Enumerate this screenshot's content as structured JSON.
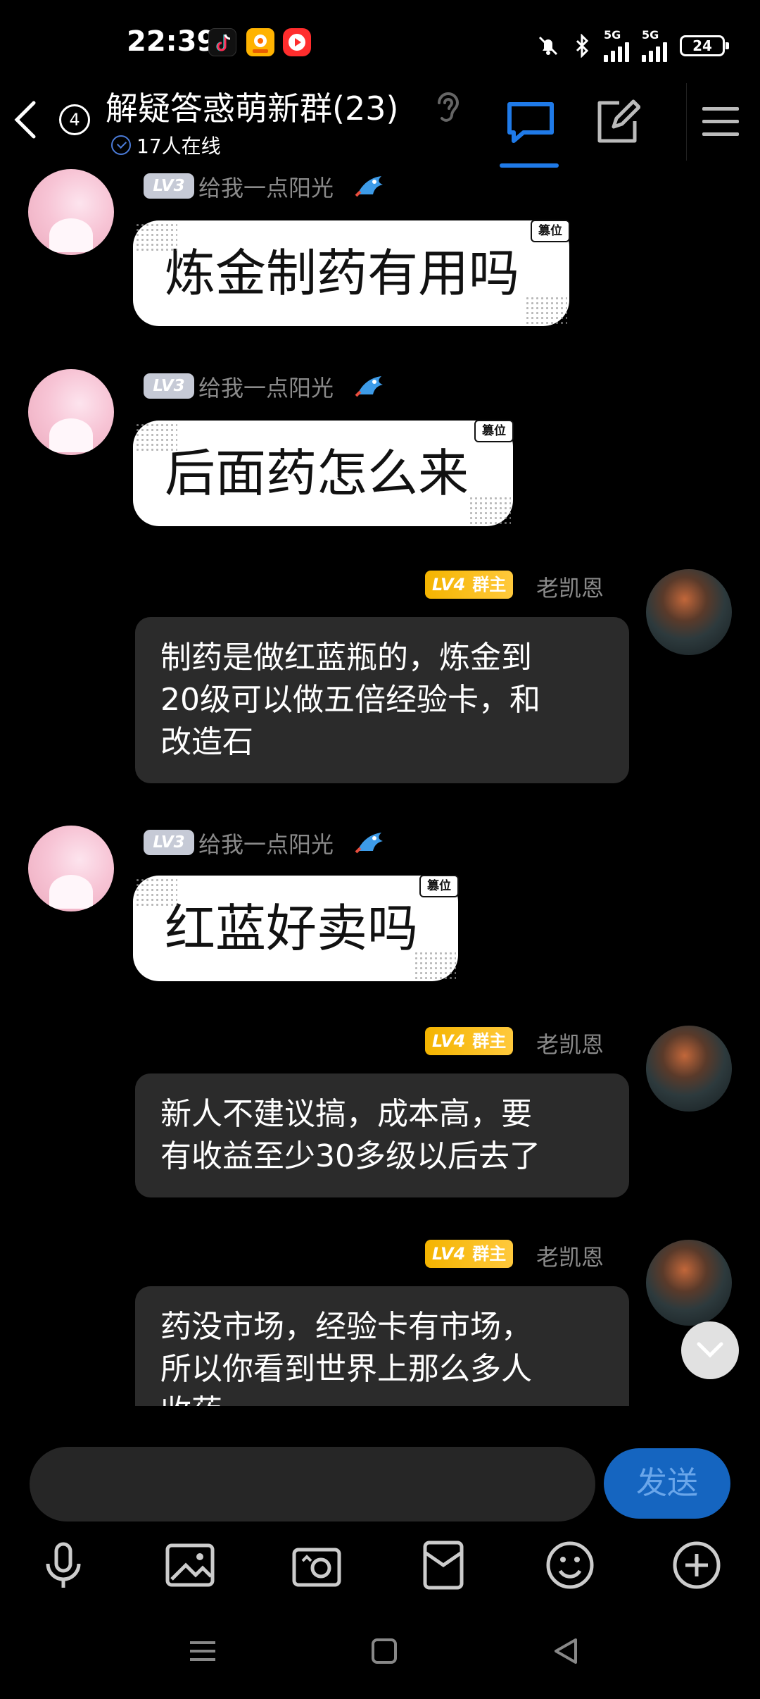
{
  "status_bar": {
    "time": "22:39",
    "network": "5G",
    "battery": "24"
  },
  "header": {
    "unread_count": "4",
    "group_title": "解疑答惑萌新群(23)",
    "online_status": "17人在线"
  },
  "messages": [
    {
      "sender": "给我一点阳光",
      "level": "LV3",
      "text": "炼金制药有用吗",
      "tag": "篡位"
    },
    {
      "sender": "给我一点阳光",
      "level": "LV3",
      "text": "后面药怎么来",
      "tag": "篡位"
    },
    {
      "sender": "老凯恩",
      "level": "LV4",
      "role": "群主",
      "lines": [
        "制药是做红蓝瓶的，炼金到",
        "20级可以做五倍经验卡，和",
        "改造石"
      ]
    },
    {
      "sender": "给我一点阳光",
      "level": "LV3",
      "text": "红蓝好卖吗",
      "tag": "篡位"
    },
    {
      "sender": "老凯恩",
      "level": "LV4",
      "role": "群主",
      "lines": [
        "新人不建议搞，成本高，要",
        "有收益至少30多级以后去了"
      ]
    },
    {
      "sender": "老凯恩",
      "level": "LV4",
      "role": "群主",
      "lines": [
        "药没市场，经验卡有市场，",
        "所以你看到世界上那么多人",
        "收药"
      ]
    }
  ],
  "composer": {
    "input_value": "",
    "send_label": "发送"
  },
  "colors": {
    "background": "#000000",
    "accent": "#1f7ae8",
    "send_button": "#1565c0",
    "owner_badge": "#f4b400",
    "dark_bubble": "#2b2b2b"
  },
  "icons": {
    "tools": [
      "microphone-icon",
      "image-icon",
      "camera-icon",
      "red-packet-icon",
      "emoji-icon",
      "plus-icon"
    ],
    "nav": [
      "recent-apps-icon",
      "home-icon",
      "back-icon"
    ]
  }
}
